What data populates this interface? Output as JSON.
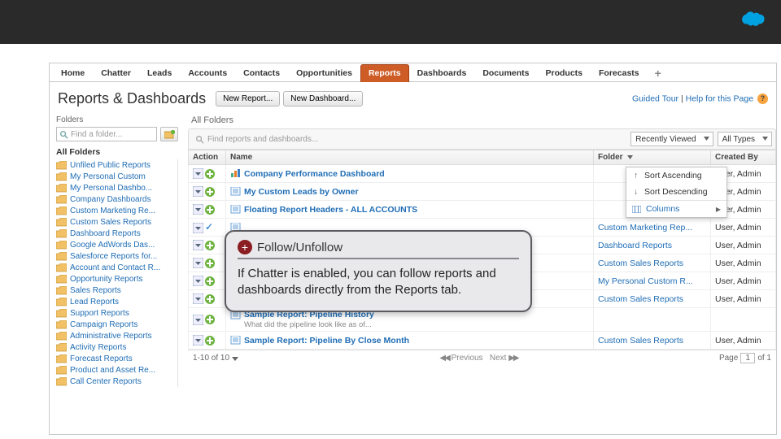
{
  "tabs": [
    "Home",
    "Chatter",
    "Leads",
    "Accounts",
    "Contacts",
    "Opportunities",
    "Reports",
    "Dashboards",
    "Documents",
    "Products",
    "Forecasts"
  ],
  "active_tab": 6,
  "page_title": "Reports & Dashboards",
  "buttons": {
    "new_report": "New Report...",
    "new_dashboard": "New Dashboard..."
  },
  "header_links": {
    "guided": "Guided Tour",
    "help": "Help for this Page"
  },
  "left": {
    "title": "Folders",
    "search_placeholder": "Find a folder...",
    "all_label": "All Folders",
    "folders": [
      "Unfiled Public Reports",
      "My Personal Custom",
      "My Personal Dashbo...",
      "Company Dashboards",
      "Custom Marketing Re...",
      "Custom Sales Reports",
      "Dashboard Reports",
      "Google AdWords Das...",
      "Salesforce Reports for...",
      "Account and Contact R...",
      "Opportunity Reports",
      "Sales Reports",
      "Lead Reports",
      "Support Reports",
      "Campaign Reports",
      "Administrative Reports",
      "Activity Reports",
      "Forecast Reports",
      "Product and Asset Re...",
      "Call Center Reports"
    ]
  },
  "right": {
    "title": "All Folders",
    "find_placeholder": "Find reports and dashboards...",
    "filter1": "Recently Viewed",
    "filter2": "All Types",
    "columns": {
      "action": "Action",
      "name": "Name",
      "folder": "Folder",
      "created": "Created By"
    }
  },
  "sort_menu": {
    "asc": "Sort Ascending",
    "desc": "Sort Descending",
    "cols": "Columns"
  },
  "rows": [
    {
      "type": "dash",
      "name": "Company Performance Dashboard",
      "folder": "",
      "created": "User, Admin"
    },
    {
      "type": "report",
      "name": "My Custom Leads by Owner",
      "folder": "",
      "created": "User, Admin"
    },
    {
      "type": "report",
      "name": "Floating Report Headers - ALL ACCOUNTS",
      "folder": "",
      "created": "User, Admin"
    },
    {
      "type": "report",
      "name": "",
      "folder": "Custom Marketing Rep...",
      "created": "User, Admin",
      "checked": true
    },
    {
      "type": "report",
      "name": "",
      "folder": "Dashboard Reports",
      "created": "User, Admin"
    },
    {
      "type": "report",
      "name": "",
      "folder": "Custom Sales Reports",
      "created": "User, Admin"
    },
    {
      "type": "report",
      "name": "",
      "folder": "My Personal Custom R...",
      "created": "User, Admin"
    },
    {
      "type": "report",
      "name": "",
      "folder": "Custom Sales Reports",
      "created": "User, Admin"
    },
    {
      "type": "report",
      "name": "Sample Report: Pipeline History",
      "desc": "What did the pipeline look like as of...",
      "folder": "",
      "created": ""
    },
    {
      "type": "report",
      "name": "Sample Report: Pipeline By Close Month",
      "folder": "Custom Sales Reports",
      "created": "User, Admin"
    }
  ],
  "pager": {
    "range": "1-10 of 10",
    "prev": "Previous",
    "next": "Next",
    "page_lbl": "Page",
    "page": "1",
    "of": "of 1"
  },
  "callout": {
    "title": "Follow/Unfollow",
    "body": "If Chatter is enabled, you can follow reports and dashboards directly from the Reports tab."
  }
}
